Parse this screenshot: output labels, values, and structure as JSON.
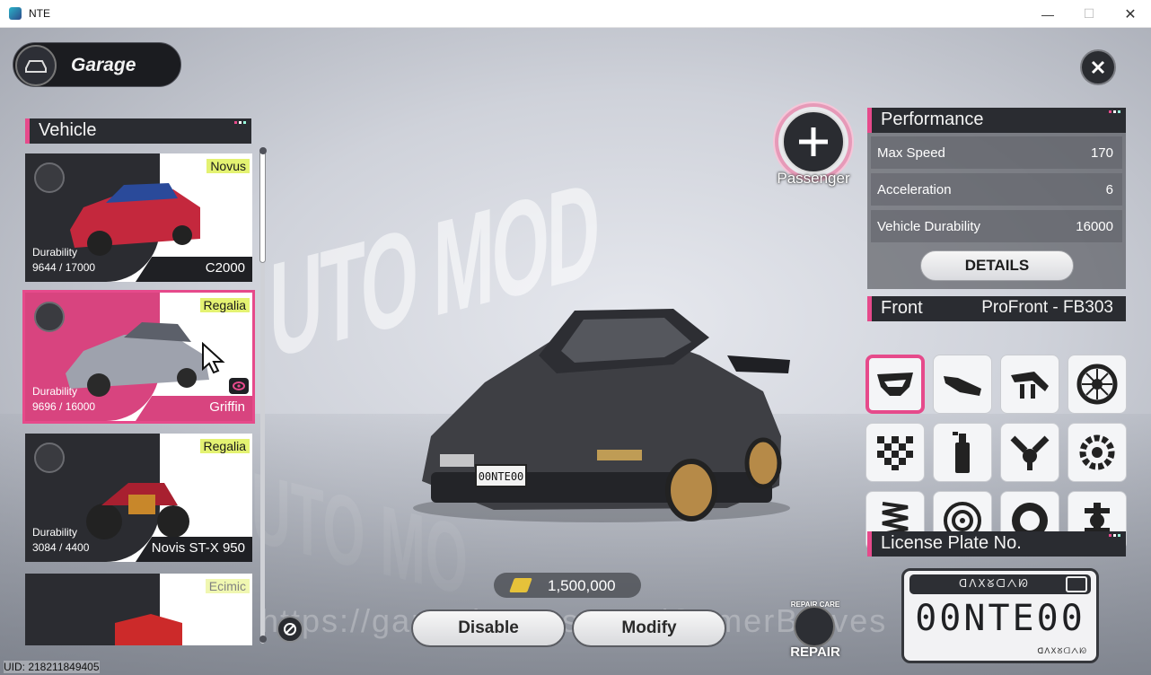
{
  "window": {
    "title": "NTE"
  },
  "header": {
    "title": "Garage"
  },
  "vehicle_panel": {
    "title": "Vehicle",
    "cards": [
      {
        "brand": "Novus",
        "durability_label": "Durability",
        "durability": "9644 / 17000",
        "name": "C2000",
        "selected": false
      },
      {
        "brand": "Regalia",
        "durability_label": "Durability",
        "durability": "9696 / 16000",
        "name": "Griffin",
        "selected": true
      },
      {
        "brand": "Regalia",
        "durability_label": "Durability",
        "durability": "3084 / 4400",
        "name": "Novis ST-X 950",
        "selected": false
      },
      {
        "brand": "Ecimic",
        "durability_label": "",
        "durability": "",
        "name": "",
        "selected": false
      }
    ]
  },
  "passenger": {
    "label": "Passenger"
  },
  "performance": {
    "title": "Performance",
    "rows": [
      {
        "label": "Max Speed",
        "value": "170"
      },
      {
        "label": "Acceleration",
        "value": "6"
      },
      {
        "label": "Vehicle Durability",
        "value": "16000"
      }
    ],
    "details_label": "DETAILS"
  },
  "front": {
    "title": "Front",
    "current_part": "ProFront - FB303",
    "parts": [
      "front-bumper-icon",
      "side-skirt-icon",
      "spoiler-icon",
      "wheel-rim-icon",
      "livery-icon",
      "spray-paint-icon",
      "engine-piston-icon",
      "transmission-gear-icon",
      "suspension-spring-icon",
      "brake-disc-icon",
      "tire-icon",
      "drivetrain-icon"
    ]
  },
  "license_plate": {
    "title": "License Plate No.",
    "number": "00NTE00",
    "top_script": "ᗡᐱꓫᘜᗡᐱᘗ",
    "bottom_script": "ᗡᐱꓫᘜᗡᐱᘗ"
  },
  "car_plate_text": "00NTE00",
  "currency": {
    "amount": "1,500,000"
  },
  "actions": {
    "disable_label": "Disable",
    "modify_label": "Modify",
    "repair_label": "REPAIR",
    "repair_ring_text": "REPAIR CARE"
  },
  "uid": "UID: 218211849405",
  "watermark": "https://gamerbraves.com/GamerBraves",
  "colors": {
    "accent": "#e64a8b",
    "brand_tag": "#e4f272",
    "panel_dark": "#2a2c31"
  }
}
